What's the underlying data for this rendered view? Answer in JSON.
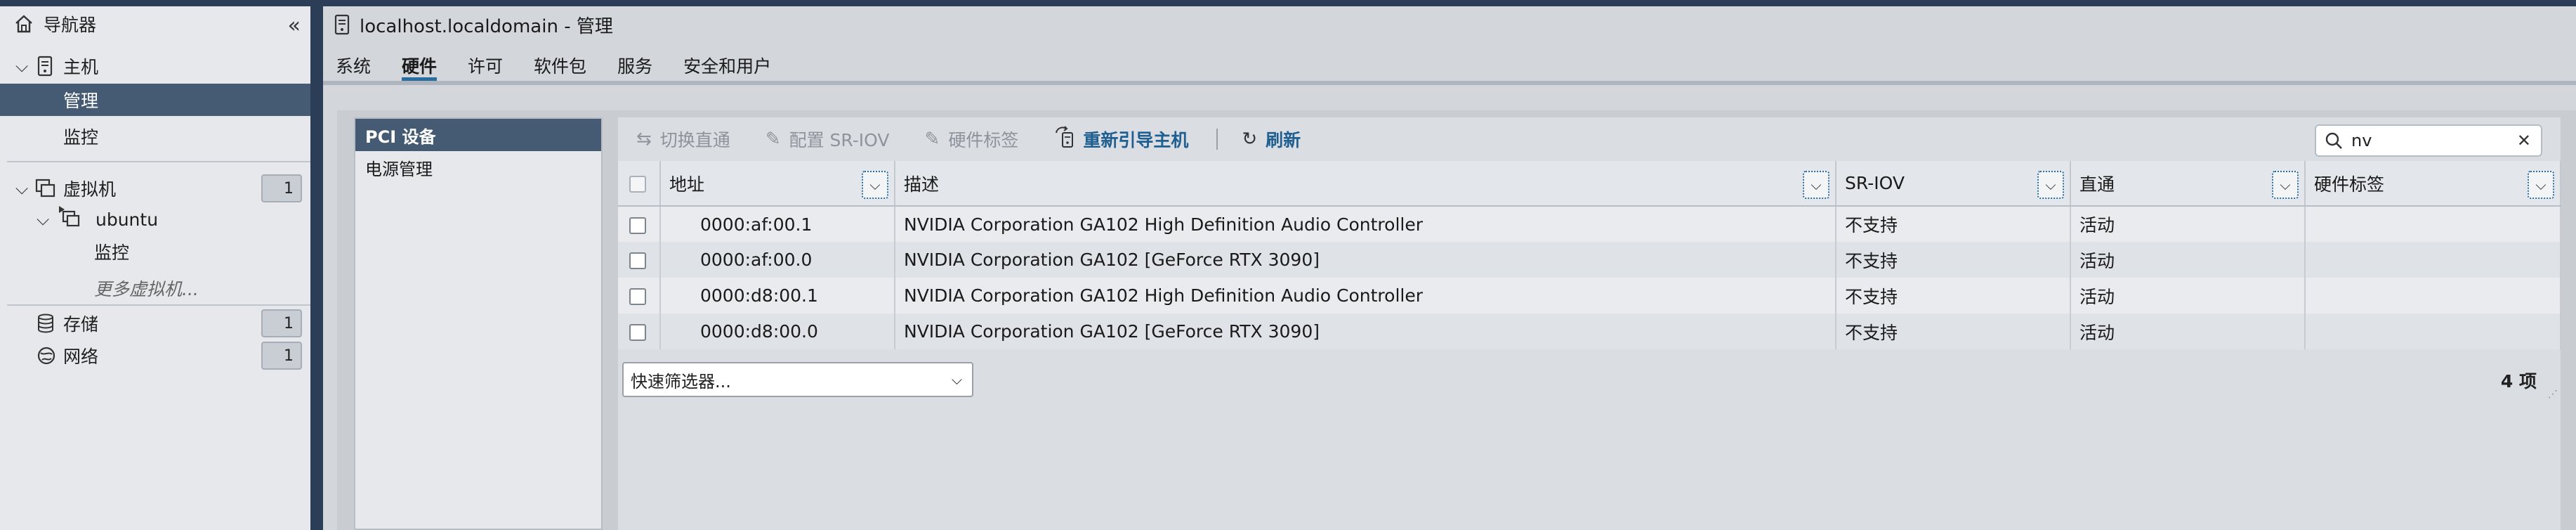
{
  "navigator": {
    "title": "导航器",
    "host": "主机",
    "manage": "管理",
    "monitor": "监控",
    "vms": "虚拟机",
    "vms_count": "1",
    "vm_name": "ubuntu",
    "vm_monitor": "监控",
    "more_vms": "更多虚拟机...",
    "storage": "存储",
    "storage_count": "1",
    "network": "网络",
    "network_count": "1"
  },
  "window": {
    "title": "localhost.localdomain - 管理"
  },
  "tabs": [
    "系统",
    "硬件",
    "许可",
    "软件包",
    "服务",
    "安全和用户"
  ],
  "active_tab": "硬件",
  "left_menu": [
    "PCI 设备",
    "电源管理"
  ],
  "toolbar": {
    "toggle_passthrough": "切换直通",
    "config_sriov": "配置 SR-IOV",
    "hw_label": "硬件标签",
    "reboot_host": "重新引导主机",
    "refresh": "刷新"
  },
  "search": {
    "value": "nv"
  },
  "table": {
    "headers": [
      "地址",
      "描述",
      "SR-IOV",
      "直通",
      "硬件标签"
    ],
    "rows": [
      [
        "0000:af:00.1",
        "NVIDIA Corporation GA102 High Definition Audio Controller",
        "不支持",
        "活动",
        ""
      ],
      [
        "0000:af:00.0",
        "NVIDIA Corporation GA102 [GeForce RTX 3090]",
        "不支持",
        "活动",
        ""
      ],
      [
        "0000:d8:00.1",
        "NVIDIA Corporation GA102 High Definition Audio Controller",
        "不支持",
        "活动",
        ""
      ],
      [
        "0000:d8:00.0",
        "NVIDIA Corporation GA102 [GeForce RTX 3090]",
        "不支持",
        "活动",
        ""
      ]
    ]
  },
  "footer": {
    "quick_filter": "快速筛选器...",
    "count": "4 项"
  },
  "colors": {
    "selected_bg": "#445b73",
    "accent": "#1f5f91",
    "frame": "#2c3e57"
  }
}
